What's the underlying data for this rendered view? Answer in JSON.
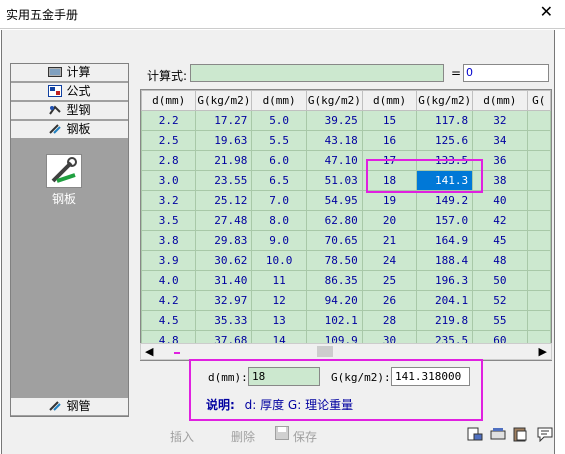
{
  "window": {
    "title": "实用五金手册"
  },
  "nav": {
    "top": [
      {
        "label": "计算",
        "icon": "calculator-icon"
      },
      {
        "label": "公式",
        "icon": "formula-icon"
      },
      {
        "label": "型钢",
        "icon": "profile-steel-icon"
      },
      {
        "label": "钢板",
        "icon": "steel-plate-icon"
      }
    ],
    "selected_label": "钢板",
    "bottom": {
      "label": "钢管",
      "icon": "steel-pipe-icon"
    }
  },
  "formula": {
    "label": "计算式:",
    "value": "",
    "equals": "=",
    "result": "0"
  },
  "grid": {
    "headers": [
      "d(mm)",
      "G(kg/m2)",
      "d(mm)",
      "G(kg/m2)",
      "d(mm)",
      "G(kg/m2)",
      "d(mm)",
      "G("
    ],
    "rows": [
      [
        "2.2",
        "17.27",
        "5.0",
        "39.25",
        "15",
        "117.8",
        "32",
        ""
      ],
      [
        "2.5",
        "19.63",
        "5.5",
        "43.18",
        "16",
        "125.6",
        "34",
        ""
      ],
      [
        "2.8",
        "21.98",
        "6.0",
        "47.10",
        "17",
        "133.5",
        "36",
        ""
      ],
      [
        "3.0",
        "23.55",
        "6.5",
        "51.03",
        "18",
        "141.3",
        "38",
        ""
      ],
      [
        "3.2",
        "25.12",
        "7.0",
        "54.95",
        "19",
        "149.2",
        "40",
        ""
      ],
      [
        "3.5",
        "27.48",
        "8.0",
        "62.80",
        "20",
        "157.0",
        "42",
        ""
      ],
      [
        "3.8",
        "29.83",
        "9.0",
        "70.65",
        "21",
        "164.9",
        "45",
        ""
      ],
      [
        "3.9",
        "30.62",
        "10.0",
        "78.50",
        "24",
        "188.4",
        "48",
        ""
      ],
      [
        "4.0",
        "31.40",
        "11",
        "86.35",
        "25",
        "196.3",
        "50",
        ""
      ],
      [
        "4.2",
        "32.97",
        "12",
        "94.20",
        "26",
        "204.1",
        "52",
        ""
      ],
      [
        "4.5",
        "35.33",
        "13",
        "102.1",
        "28",
        "219.8",
        "55",
        ""
      ],
      [
        "4.8",
        "37.68",
        "14",
        "109.9",
        "30",
        "235.5",
        "60",
        ""
      ]
    ]
  },
  "scroll": {
    "left": "◀",
    "right": "▶"
  },
  "calc": {
    "d_label": "d(mm):",
    "d_value": "18",
    "g_label": "G(kg/m2):",
    "g_value": "141.318000",
    "explain_title": "说明:",
    "explain_text": "d: 厚度  G: 理论重量"
  },
  "toolbar": {
    "insert": "插入",
    "delete": "删除",
    "save": "保存"
  },
  "colors": {
    "grid_bg": "#cce8cf",
    "highlight": "#e020e0",
    "selection": "#0078d7"
  }
}
